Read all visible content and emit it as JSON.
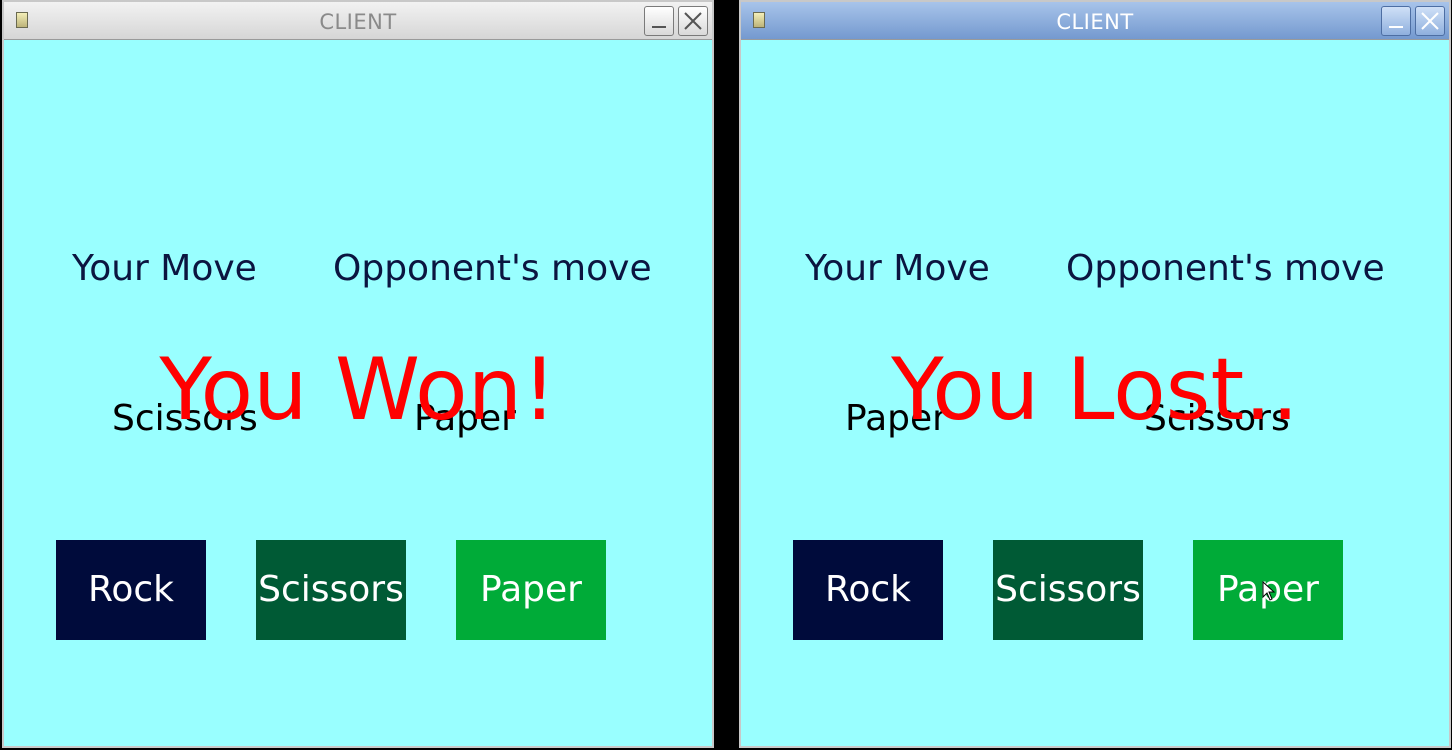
{
  "colors": {
    "client_bg": "#99ffff",
    "result_text": "#ff0000",
    "rock_button": "#000b3b",
    "scissors_button": "#005a35",
    "paper_button": "#00ab38"
  },
  "windows": [
    {
      "title": "CLIENT",
      "state": "inactive",
      "labels": {
        "your_move": "Your Move",
        "opponent_move": "Opponent's move"
      },
      "your_move_value": "Scissors",
      "opponent_move_value": "Paper",
      "result": "You Won!",
      "buttons": {
        "rock": "Rock",
        "scissors": "Scissors",
        "paper": "Paper"
      }
    },
    {
      "title": "CLIENT",
      "state": "active",
      "labels": {
        "your_move": "Your Move",
        "opponent_move": "Opponent's move"
      },
      "your_move_value": "Paper",
      "opponent_move_value": "Scissors",
      "result": "You Lost..",
      "buttons": {
        "rock": "Rock",
        "scissors": "Scissors",
        "paper": "Paper"
      }
    }
  ]
}
